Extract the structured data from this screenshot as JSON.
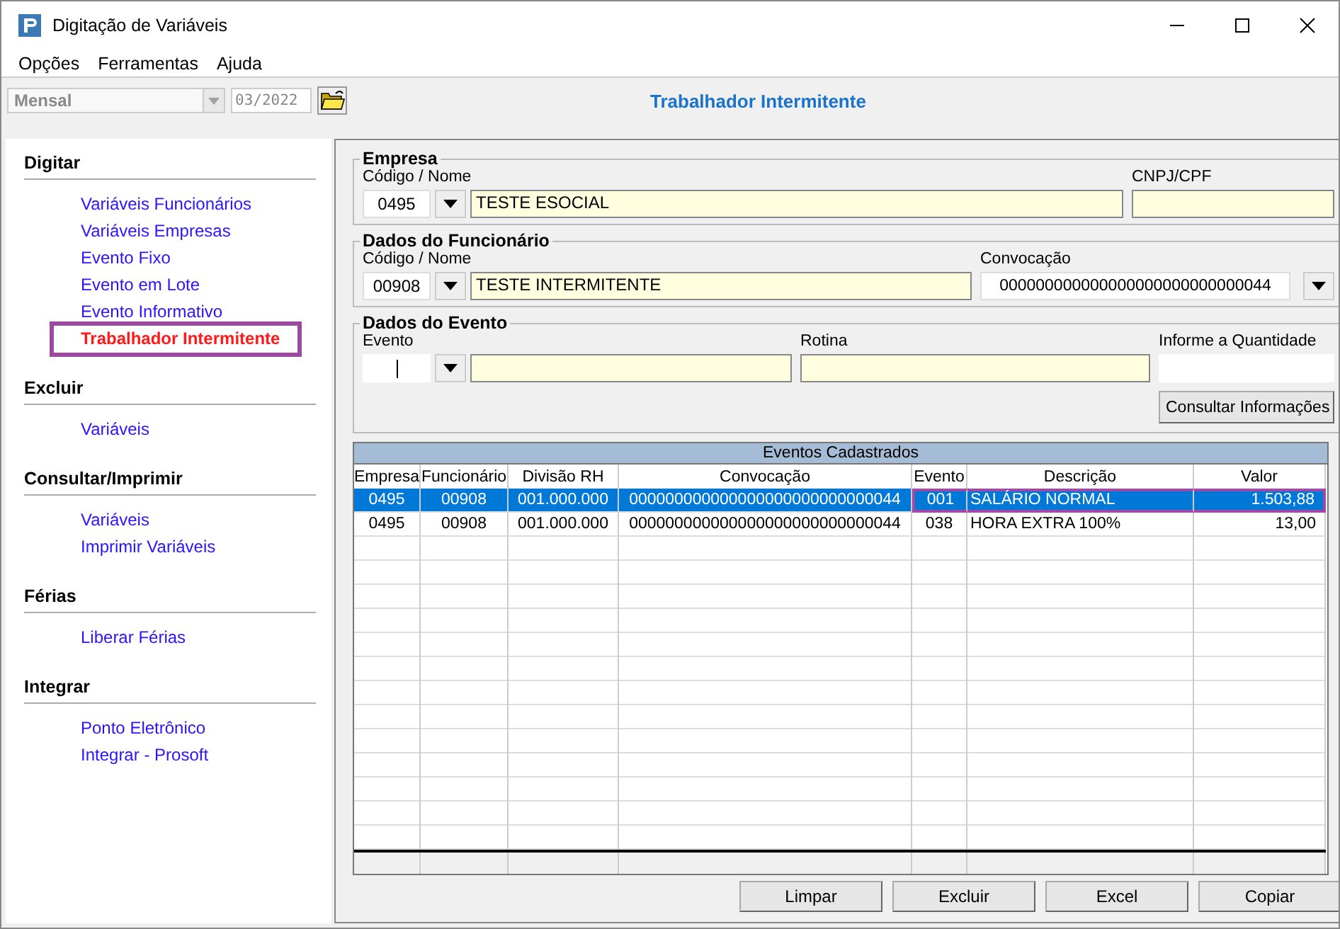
{
  "window": {
    "title": "Digitação de Variáveis"
  },
  "menu": [
    "Opções",
    "Ferramentas",
    "Ajuda"
  ],
  "toolbar": {
    "period": {
      "value": "Mensal",
      "disabled": true
    },
    "date": {
      "value": "03/2022",
      "disabled": true
    }
  },
  "page_title": "Trabalhador Intermitente",
  "sidebar": {
    "sections": [
      {
        "title": "Digitar",
        "items": [
          {
            "label": "Variáveis Funcionários",
            "selected": false,
            "outlined": false
          },
          {
            "label": "Variáveis Empresas",
            "selected": false,
            "outlined": false
          },
          {
            "label": "Evento Fixo",
            "selected": false,
            "outlined": false
          },
          {
            "label": "Evento em Lote",
            "selected": false,
            "outlined": false
          },
          {
            "label": "Evento Informativo",
            "selected": false,
            "outlined": false
          },
          {
            "label": "Trabalhador Intermitente",
            "selected": true,
            "outlined": true
          }
        ]
      },
      {
        "title": "Excluir",
        "items": [
          {
            "label": "Variáveis",
            "selected": false,
            "outlined": false
          }
        ]
      },
      {
        "title": "Consultar/Imprimir",
        "items": [
          {
            "label": "Variáveis",
            "selected": false,
            "outlined": false
          },
          {
            "label": "Imprimir Variáveis",
            "selected": false,
            "outlined": false
          }
        ]
      },
      {
        "title": "Férias",
        "items": [
          {
            "label": "Liberar Férias",
            "selected": false,
            "outlined": false
          }
        ]
      },
      {
        "title": "Integrar",
        "items": [
          {
            "label": "Ponto Eletrônico",
            "selected": false,
            "outlined": false
          },
          {
            "label": "Integrar - Prosoft",
            "selected": false,
            "outlined": false
          }
        ]
      }
    ]
  },
  "empresa": {
    "title": "Empresa",
    "code_label": "Código / Nome",
    "code": "0495",
    "name": "TESTE ESOCIAL",
    "cnpj_label": "CNPJ/CPF"
  },
  "funcionario": {
    "title": "Dados do Funcionário",
    "code_label": "Código / Nome",
    "code": "00908",
    "name": "TESTE INTERMITENTE",
    "convocacao_label": "Convocação",
    "convocacao": "000000000000000000000000000044"
  },
  "evento": {
    "title": "Dados do Evento",
    "evento_label": "Evento",
    "rotina_label": "Rotina",
    "quantidade_label": "Informe a Quantidade",
    "consult_button": "Consultar Informações"
  },
  "table": {
    "title": "Eventos Cadastrados",
    "columns": [
      "Empresa",
      "Funcionário",
      "Divisão RH",
      "Convocação",
      "Evento",
      "Descrição",
      "Valor"
    ],
    "rows": [
      {
        "selected": true,
        "cells": [
          {
            "text": "0495",
            "outlined": false
          },
          {
            "text": "00908",
            "outlined": false
          },
          {
            "text": "001.000.000",
            "outlined": false
          },
          {
            "text": "000000000000000000000000000044",
            "outlined": false
          },
          {
            "text": "001",
            "outlined": true
          },
          {
            "text": "SALÁRIO NORMAL",
            "outlined": true
          },
          {
            "text": "1.503,88",
            "outlined": true
          }
        ]
      },
      {
        "selected": false,
        "cells": [
          {
            "text": "0495",
            "outlined": false
          },
          {
            "text": "00908",
            "outlined": false
          },
          {
            "text": "001.000.000",
            "outlined": false
          },
          {
            "text": "000000000000000000000000000044",
            "outlined": false
          },
          {
            "text": "038",
            "outlined": false
          },
          {
            "text": "HORA EXTRA 100%",
            "outlined": false
          },
          {
            "text": "13,00",
            "outlined": false
          }
        ]
      }
    ]
  },
  "buttons": [
    "Limpar",
    "Excluir",
    "Excel",
    "Copiar"
  ]
}
